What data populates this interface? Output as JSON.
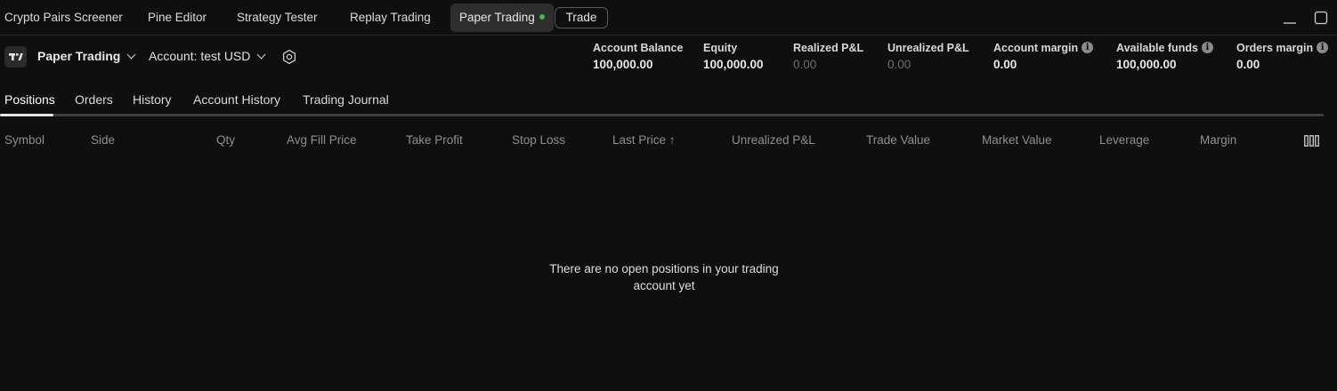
{
  "top_tabs": [
    {
      "label": "Crypto Pairs Screener"
    },
    {
      "label": "Pine Editor"
    },
    {
      "label": "Strategy Tester"
    },
    {
      "label": "Replay Trading"
    },
    {
      "label": "Paper Trading"
    }
  ],
  "trade_button": "Trade",
  "colors": {
    "background": "#0f0f0f",
    "active_tab": "#2e2e2e",
    "live_dot": "#4caf50",
    "muted": "#8f8f8f"
  },
  "account": {
    "broker_name": "Paper Trading",
    "account_select": "Account: test USD"
  },
  "stats": [
    {
      "label": "Account Balance",
      "value": "100,000.00"
    },
    {
      "label": "Equity",
      "value": "100,000.00"
    },
    {
      "label": "Realized P&L",
      "value": "0.00"
    },
    {
      "label": "Unrealized P&L",
      "value": "0.00"
    },
    {
      "label": "Account margin",
      "value": "0.00"
    },
    {
      "label": "Available funds",
      "value": "100,000.00"
    },
    {
      "label": "Orders margin",
      "value": "0.00"
    }
  ],
  "sub_tabs": [
    {
      "label": "Positions"
    },
    {
      "label": "Orders"
    },
    {
      "label": "History"
    },
    {
      "label": "Account History"
    },
    {
      "label": "Trading Journal"
    }
  ],
  "columns": [
    "Symbol",
    "Side",
    "Qty",
    "Avg Fill Price",
    "Take Profit",
    "Stop Loss",
    "Last Price ↑",
    "Unrealized P&L",
    "Trade Value",
    "Market Value",
    "Leverage",
    "Margin"
  ],
  "empty_state": {
    "line1": "There are no open positions in your trading",
    "line2": "account yet"
  }
}
